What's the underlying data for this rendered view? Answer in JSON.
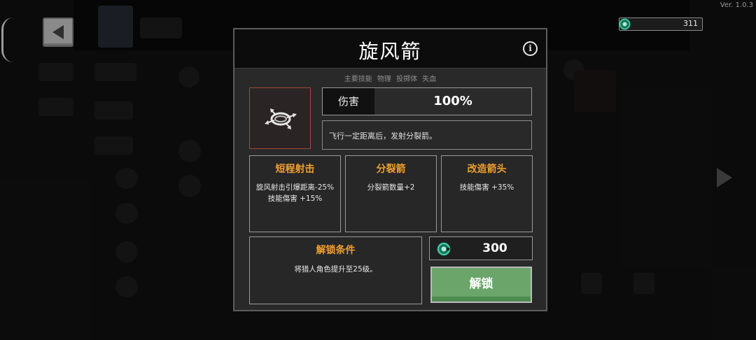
{
  "version": "Ver. 1.0.3",
  "currency": {
    "amount": "311",
    "icon": "green-gem-icon"
  },
  "dialog": {
    "title": "旋风箭",
    "tags": [
      "主要技能",
      "物理",
      "投掷体",
      "失血"
    ],
    "damage_label": "伤害",
    "damage_value": "100%",
    "description": "飞行一定距离后，发射分裂箭。",
    "modifiers": [
      {
        "title": "短程射击",
        "lines": [
          "旋风射击引爆距离-25%",
          "技能傷害 +15%"
        ]
      },
      {
        "title": "分裂箭",
        "lines": [
          "分裂箭数量+2"
        ]
      },
      {
        "title": "改造箭头",
        "lines": [
          "技能傷害 +35%"
        ]
      }
    ],
    "unlock_condition": {
      "title": "解锁条件",
      "text": "将猎人角色提升至25级。"
    },
    "cost": "300",
    "unlock_button": "解锁"
  },
  "colors": {
    "accent_orange": "#f0a030",
    "button_green": "#6ba56a",
    "icon_border_red": "#a34a3c",
    "gem_teal": "#3cc8a0"
  }
}
